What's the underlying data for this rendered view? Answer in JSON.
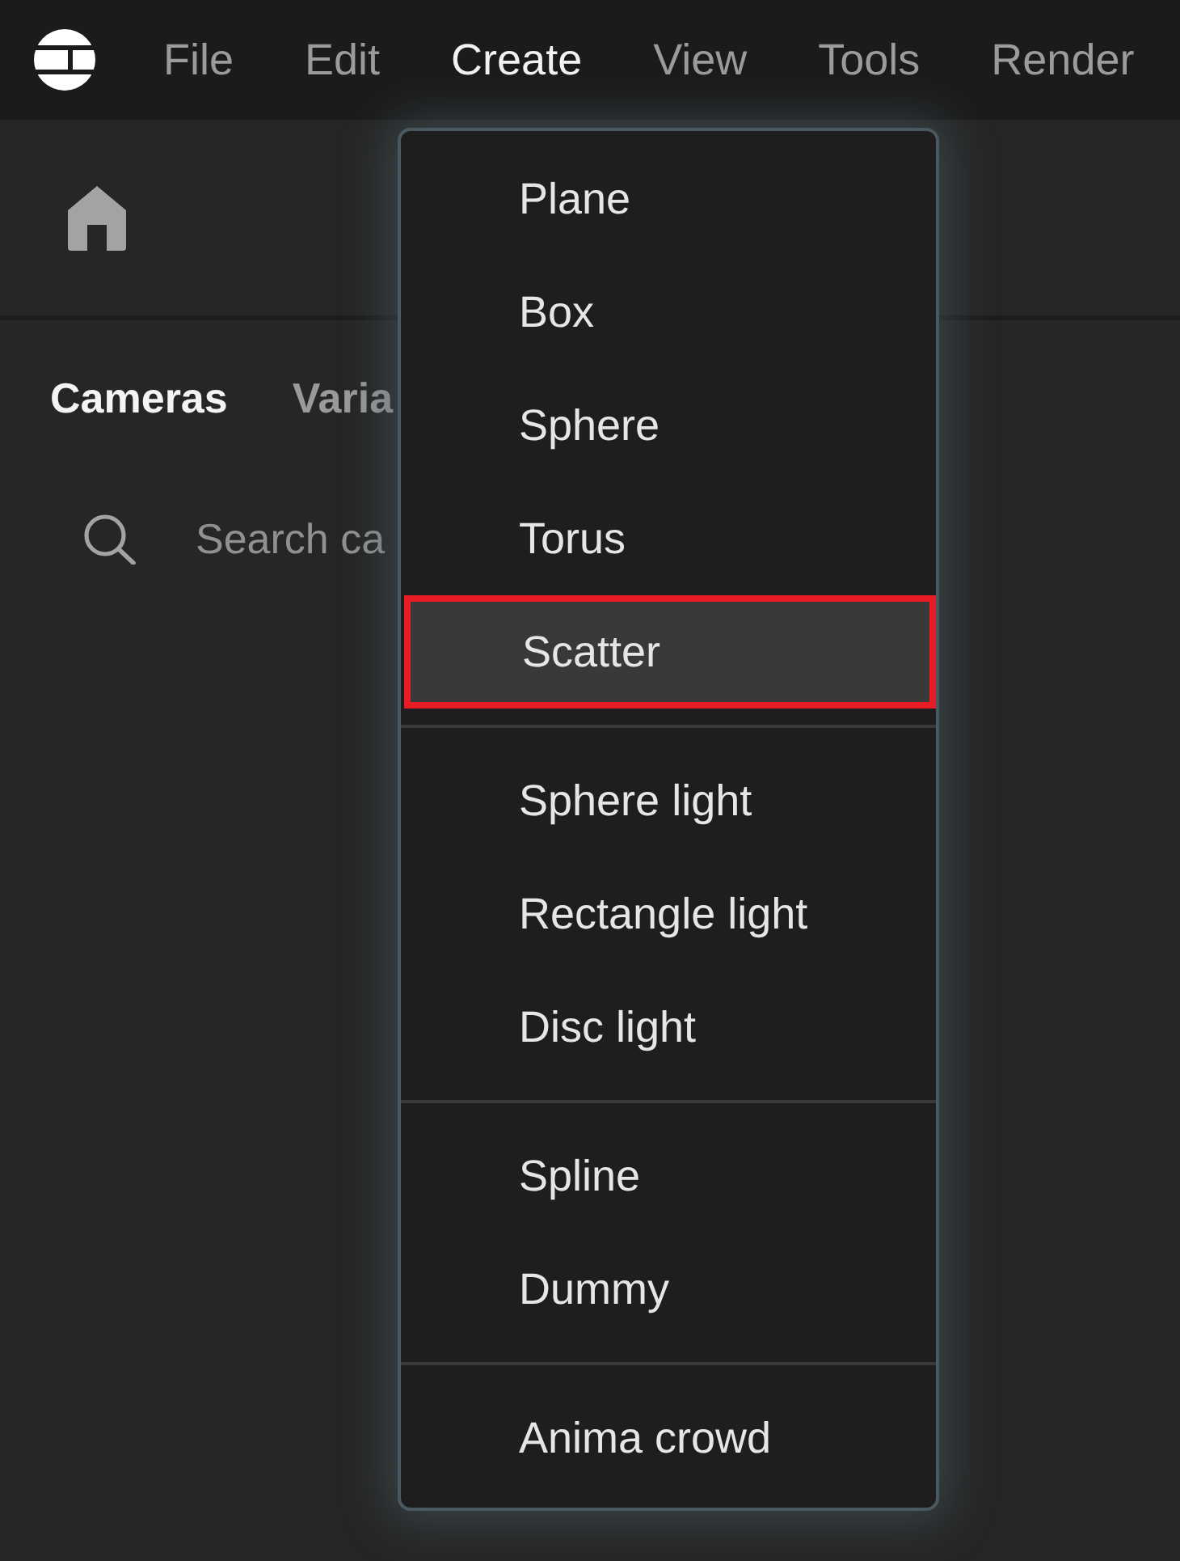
{
  "menubar": {
    "items": [
      {
        "label": "File",
        "selected": false
      },
      {
        "label": "Edit",
        "selected": false
      },
      {
        "label": "Create",
        "selected": true
      },
      {
        "label": "View",
        "selected": false
      },
      {
        "label": "Tools",
        "selected": false
      },
      {
        "label": "Render",
        "selected": false
      }
    ]
  },
  "panel": {
    "tabs": [
      {
        "label": "Cameras",
        "selected": true
      },
      {
        "label": "Varia",
        "selected": false
      }
    ],
    "search": {
      "placeholder": "Search ca"
    }
  },
  "dropdown": {
    "groups": [
      {
        "items": [
          {
            "label": "Plane",
            "highlighted": false
          },
          {
            "label": "Box",
            "highlighted": false
          },
          {
            "label": "Sphere",
            "highlighted": false
          },
          {
            "label": "Torus",
            "highlighted": false
          },
          {
            "label": "Scatter",
            "highlighted": true
          }
        ]
      },
      {
        "items": [
          {
            "label": "Sphere light",
            "highlighted": false
          },
          {
            "label": "Rectangle light",
            "highlighted": false
          },
          {
            "label": "Disc light",
            "highlighted": false
          }
        ]
      },
      {
        "items": [
          {
            "label": "Spline",
            "highlighted": false
          },
          {
            "label": "Dummy",
            "highlighted": false
          }
        ]
      },
      {
        "items": [
          {
            "label": "Anima crowd",
            "highlighted": false
          }
        ]
      }
    ]
  }
}
